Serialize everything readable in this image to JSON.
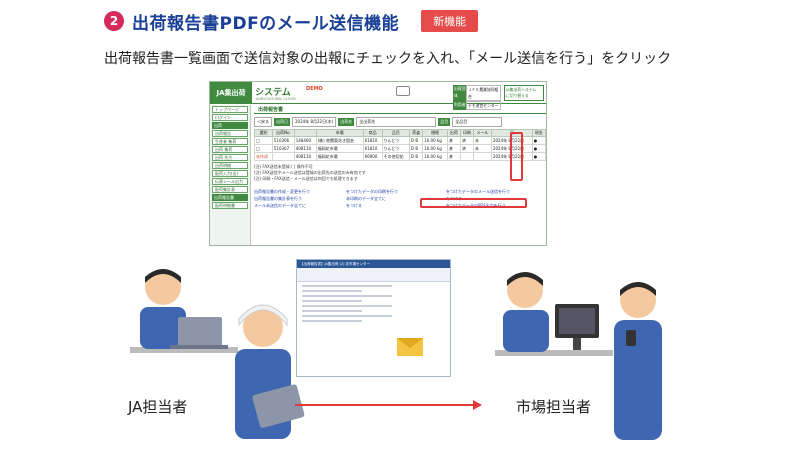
{
  "header": {
    "number": "2",
    "title": "出荷報告書PDFのメール送信機能",
    "badge": "新機能"
  },
  "description": "出荷報告書一覧画面で送信対象の出報にチェックを入れ、「メール送信を行う」をクリック",
  "app": {
    "logo": "JA集出荷",
    "name": "システム",
    "demo": "DEMO",
    "subtitle": "AGRICULTURAL CLOUD",
    "user_rows": [
      {
        "label": "出荷団体",
        "value": "ＪＦＥ農業協同組合"
      },
      {
        "label": "利用者",
        "value": "デモ運営センター"
      }
    ],
    "sys_name": "JA集出荷システム",
    "sys_sub": "に切り替える",
    "sidebar": [
      {
        "label": "トップページ",
        "type": "item"
      },
      {
        "label": "ログイン",
        "type": "item"
      },
      {
        "label": "出荷",
        "type": "group"
      },
      {
        "label": "出荷報告",
        "type": "item"
      },
      {
        "label": "生産者 集荷",
        "type": "item"
      },
      {
        "label": "出荷 集荷",
        "type": "item"
      },
      {
        "label": "出荷 先方",
        "type": "item"
      },
      {
        "label": "出荷明細",
        "type": "item"
      },
      {
        "label": "配荷入力(出)",
        "type": "item"
      },
      {
        "label": "伝票シール出力",
        "type": "item"
      },
      {
        "label": "配荷集計表",
        "type": "item"
      },
      {
        "label": "出荷報告書",
        "type": "group"
      },
      {
        "label": "配荷明細書",
        "type": "item"
      }
    ],
    "section_title": "出荷報告書",
    "filter": {
      "back": "＜戻る",
      "date_label": "出荷日",
      "date_value": "2024年 8月22日(木)",
      "dest_label": "出荷先",
      "dest_value": "全出荷先",
      "item_label": "品目",
      "item_value": "全品目"
    },
    "columns": [
      "選択",
      "出荷No.",
      "",
      "市場",
      "商品",
      "品目",
      "荷姿",
      "規格",
      "出荷",
      "印刷",
      "メール",
      "日",
      "現金"
    ],
    "rows": [
      [
        "□",
        "510366",
        "148460",
        "(株) 南関東花き園芸",
        "61810",
        "りんどう",
        "D B",
        "10.00 kg",
        "済",
        "済",
        "未",
        "2024年 8月22日",
        "●"
      ],
      [
        "□",
        "510367",
        "408110",
        "福岡花市場",
        "61810",
        "りんどう",
        "D B",
        "10.00 kg",
        "済",
        "済",
        "未",
        "2024年 8月22日",
        "●"
      ],
      [
        "未作成",
        "",
        "408110",
        "福岡花市場",
        "66900",
        "その他切花",
        "D B",
        "10.00 kg",
        "済",
        "",
        "",
        "2024年 8月22日",
        "●"
      ]
    ],
    "notes": [
      "(注) FAX送信未登録 (  ) 操作不可",
      "(注) FAX送信やメール送信は登録の出荷先の送信のみ有効です",
      "(注) 印刷・FAX送信・メール送信は何回でも処理できます"
    ],
    "links": [
      "出荷報告書の作成・変更を行う",
      "をつけたデータの印刷を行う",
      "をつけたデータのメール送信を行う",
      "出荷報告書の集計表を行う",
      "未印刷のデータ全てに",
      "をつける",
      "メール未送信のデータ全てに",
      "をつける",
      "をつけたデータのPDF出力を行う"
    ]
  },
  "mail": {
    "title_bar": "【出荷報告書】JA集出荷  (2) 花市場センター"
  },
  "labels": {
    "ja": "JA担当者",
    "market": "市場担当者"
  },
  "colors": {
    "accent": "#1a3f96",
    "green": "#3f8a3f",
    "red": "#e23a3a",
    "badge": "#e64b4b"
  }
}
